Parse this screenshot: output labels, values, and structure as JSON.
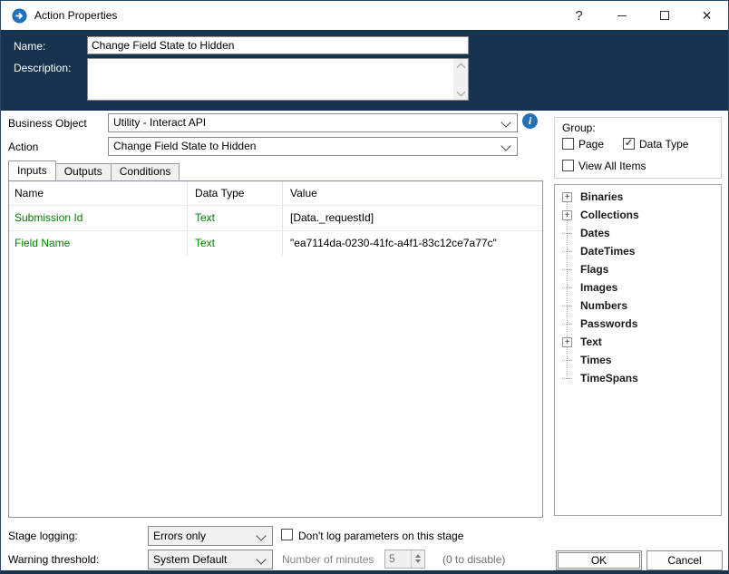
{
  "window": {
    "title": "Action Properties",
    "controls": {
      "help": "?",
      "close": "×"
    }
  },
  "header": {
    "name_label": "Name:",
    "name_value": "Change Field State to Hidden",
    "description_label": "Description:",
    "description_value": ""
  },
  "form": {
    "business_object_label": "Business Object",
    "business_object_value": "Utility - Interact API",
    "action_label": "Action",
    "action_value": "Change Field State to Hidden"
  },
  "tabs": [
    {
      "label": "Inputs",
      "selected": true
    },
    {
      "label": "Outputs",
      "selected": false
    },
    {
      "label": "Conditions",
      "selected": false
    }
  ],
  "inputs_table": {
    "columns": [
      "Name",
      "Data Type",
      "Value"
    ],
    "rows": [
      {
        "name": "Submission Id",
        "data_type": "Text",
        "value": "[Data._requestId]"
      },
      {
        "name": "Field Name",
        "data_type": "Text",
        "value": "\"ea7114da-0230-41fc-a4f1-83c12ce7a77c\""
      }
    ]
  },
  "group_panel": {
    "label": "Group:",
    "checkboxes": [
      {
        "label": "Page",
        "checked": false
      },
      {
        "label": "Data Type",
        "checked": true
      },
      {
        "label": "View All Items",
        "checked": false
      }
    ]
  },
  "tree": {
    "items": [
      {
        "label": "Binaries",
        "expandable": true
      },
      {
        "label": "Collections",
        "expandable": true
      },
      {
        "label": "Dates",
        "expandable": false
      },
      {
        "label": "DateTimes",
        "expandable": false
      },
      {
        "label": "Flags",
        "expandable": false
      },
      {
        "label": "Images",
        "expandable": false
      },
      {
        "label": "Numbers",
        "expandable": false
      },
      {
        "label": "Passwords",
        "expandable": false
      },
      {
        "label": "Text",
        "expandable": true
      },
      {
        "label": "Times",
        "expandable": false
      },
      {
        "label": "TimeSpans",
        "expandable": false
      }
    ]
  },
  "footer": {
    "stage_logging_label": "Stage logging:",
    "stage_logging_value": "Errors only",
    "dont_log_label": "Don't log parameters on this stage",
    "warning_threshold_label": "Warning threshold:",
    "warning_threshold_value": "System Default",
    "minutes_label": "Number of minutes",
    "minutes_value": "5",
    "disable_hint": "(0 to disable)",
    "ok_label": "OK",
    "cancel_label": "Cancel"
  },
  "icons": {
    "check": "✓",
    "plus": "+",
    "info": "i"
  },
  "colors": {
    "header_bg": "#16334F",
    "param_green": "#008000",
    "info_blue": "#2272B8"
  }
}
